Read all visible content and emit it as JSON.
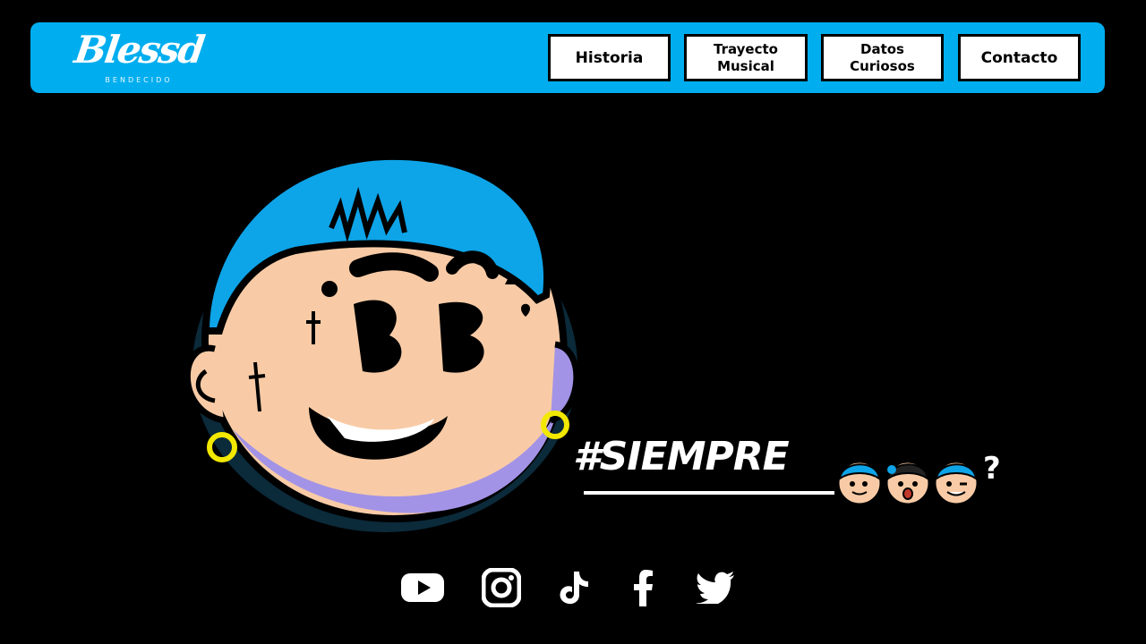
{
  "brand": {
    "logo_text": "Blessd",
    "logo_subtitle": "BENDECIDO",
    "accent_color": "#00aeef"
  },
  "nav": {
    "items": [
      {
        "label": "Historia"
      },
      {
        "label": "Trayecto Musical"
      },
      {
        "label": "Datos Curiosos"
      },
      {
        "label": "Contacto"
      }
    ]
  },
  "hero": {
    "mascot_icon": "cartoon-face-mascot",
    "hashtag": "#SIEMPRE",
    "question_mark": "?"
  },
  "socials": [
    {
      "icon": "youtube-icon"
    },
    {
      "icon": "instagram-icon"
    },
    {
      "icon": "tiktok-icon"
    },
    {
      "icon": "facebook-icon"
    },
    {
      "icon": "twitter-icon"
    }
  ]
}
